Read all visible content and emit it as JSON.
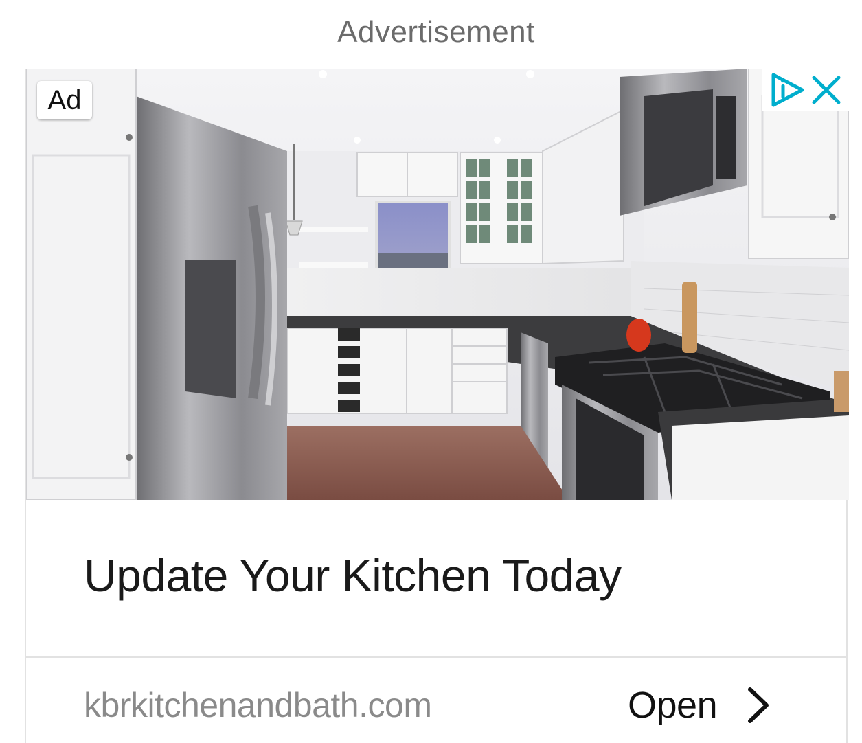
{
  "header": {
    "label": "Advertisement"
  },
  "ad": {
    "badge": "Ad",
    "headline": "Update Your Kitchen Today",
    "domain": "kbrkitchenandbath.com",
    "cta_label": "Open",
    "image_subject": "white kitchen with stainless steel refrigerator, gas range and microwave",
    "icons": {
      "adchoices": "adchoices-icon",
      "close": "close-icon",
      "cta": "chevron-right-icon"
    }
  },
  "colors": {
    "adchoices_accent": "#00aecd",
    "headline": "#1a1a1a",
    "domain": "#8a8a8a"
  }
}
